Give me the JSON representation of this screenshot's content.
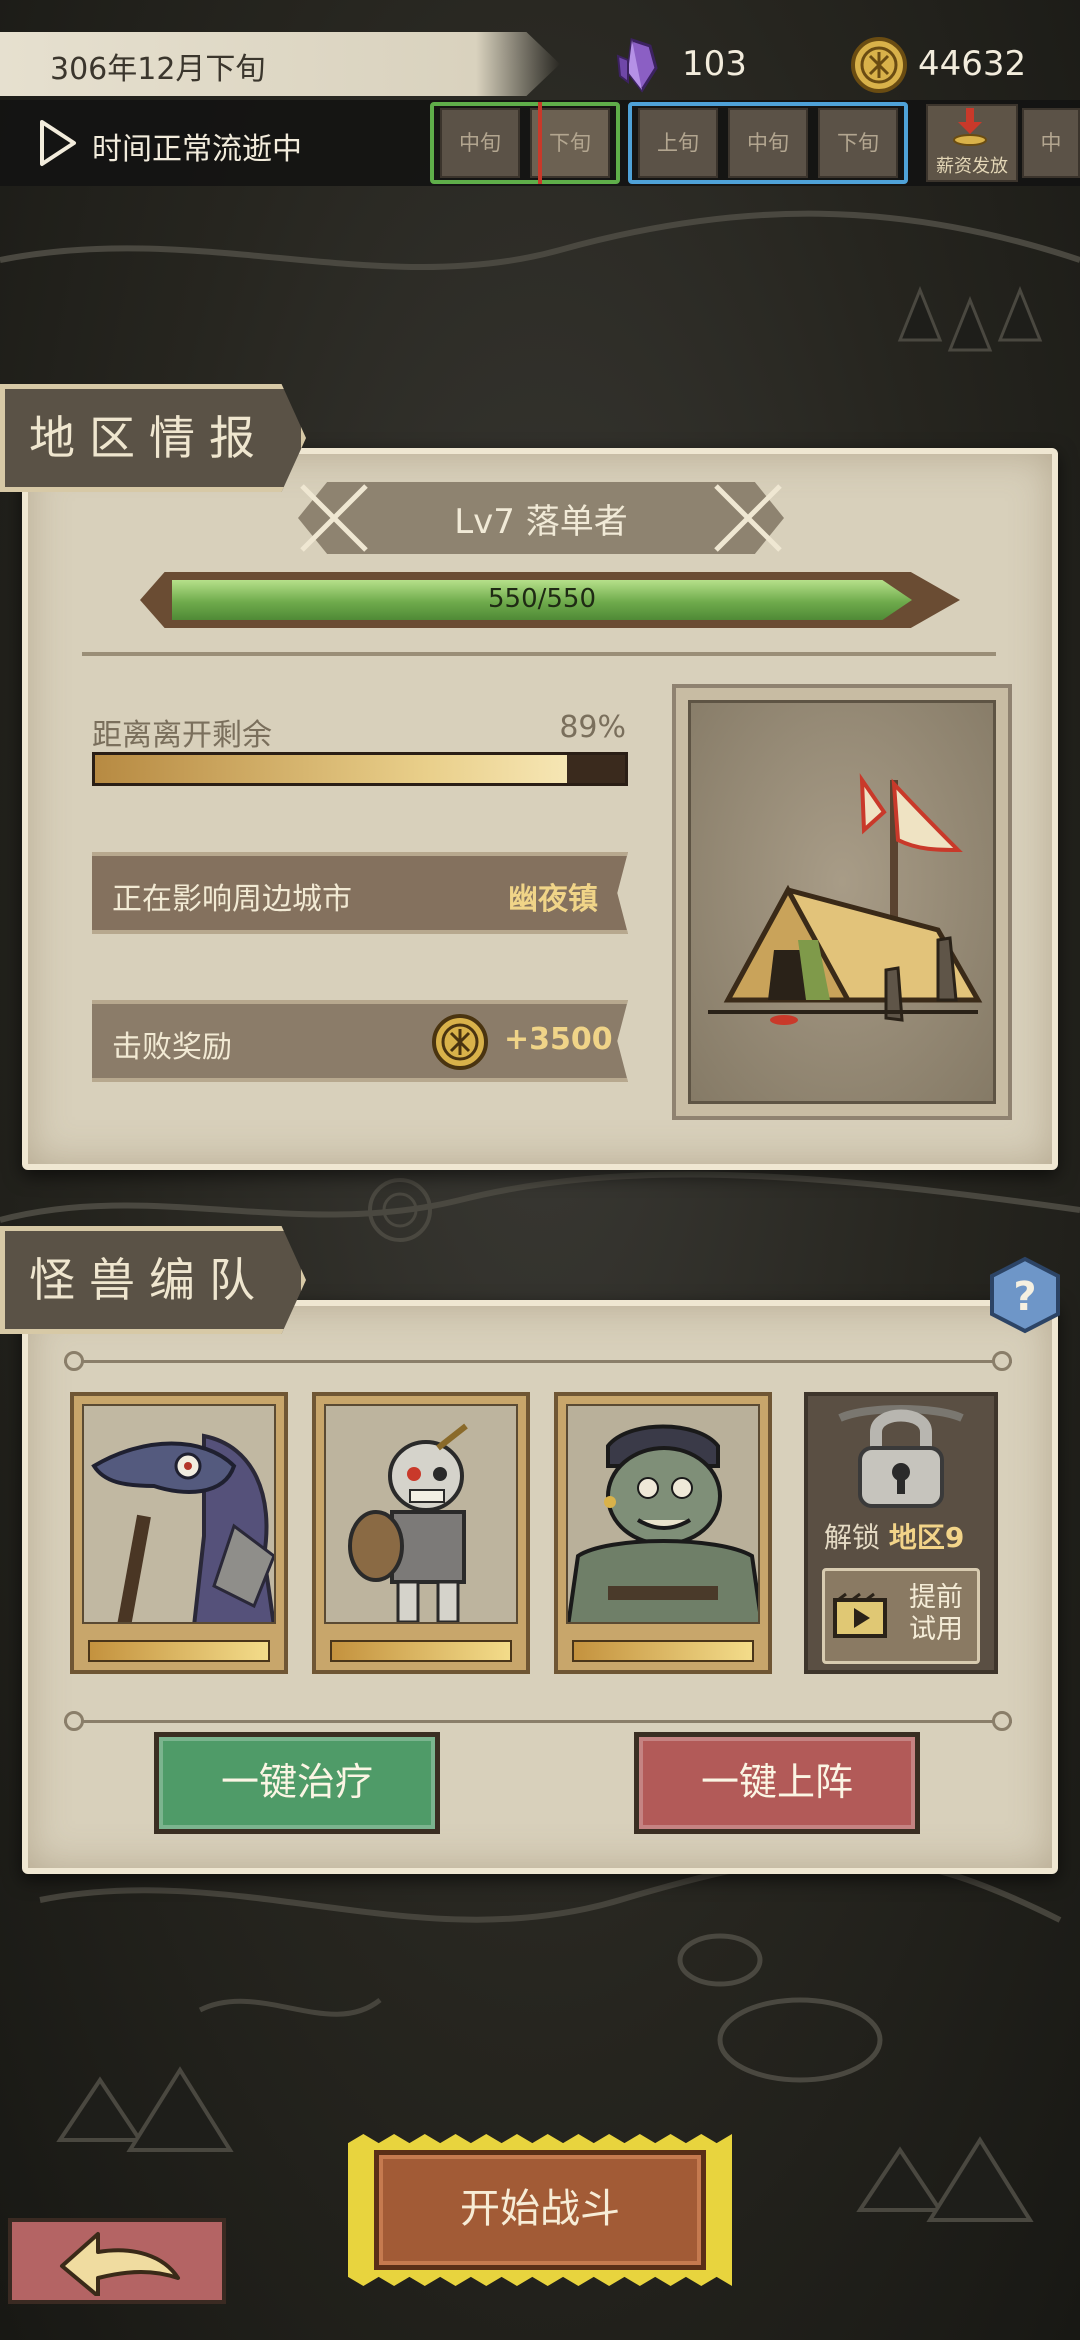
{
  "header": {
    "date": "306年12月下旬",
    "crystal_count": "103",
    "coin_count": "44632",
    "time_status": "时间正常流逝中",
    "icons": [
      "crystal-icon",
      "coin-icon",
      "play-icon"
    ]
  },
  "calendar": {
    "segments": [
      "中旬",
      "下旬",
      "上旬",
      "中旬",
      "下旬",
      "中"
    ],
    "salary_label": "薪资发放",
    "colors": {
      "current_month_border": "#5fae4a",
      "next_month_border": "#4fa2d8",
      "marker": "#c9392a"
    }
  },
  "region": {
    "tab_label": "地区情报",
    "level_title": "Lv7 落单者",
    "hp_text": "550/550",
    "hp_fraction": 1.0,
    "leave_label": "距离离开剩余",
    "leave_percent": "89%",
    "leave_fraction": 0.89,
    "affect_label": "正在影响周边城市",
    "affect_city": "幽夜镇",
    "reward_label": "击败奖励",
    "reward_value": "+3500",
    "enemy_icon": "tent-icon"
  },
  "squad": {
    "tab_label": "怪兽编队",
    "monsters": [
      {
        "icon": "crow-monster-icon",
        "hp_fraction": 1.0
      },
      {
        "icon": "skeleton-knight-icon",
        "hp_fraction": 1.0
      },
      {
        "icon": "ogre-icon",
        "hp_fraction": 1.0
      }
    ],
    "unlock_prefix": "解锁",
    "unlock_area": "地区9",
    "trial_label": "提前\n试用",
    "heal_all": "一键治疗",
    "deploy_all": "一键上阵"
  },
  "footer": {
    "start_battle": "开始战斗",
    "back_icon": "back-arrow-icon"
  },
  "colors": {
    "heal_button": "#4f9b68",
    "deploy_button": "#b25a58",
    "battle_button": "#a25b36",
    "battle_frame": "#e8d43e",
    "hp_green": "#6fab4c",
    "reward_gold": "#f0d488"
  }
}
